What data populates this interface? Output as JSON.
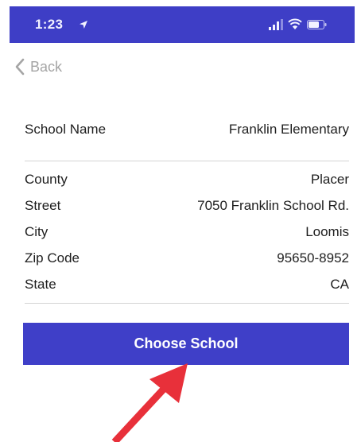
{
  "status_bar": {
    "time": "1:23",
    "location_icon": "location-arrow-icon",
    "signal_icon": "cellular-signal-icon",
    "wifi_icon": "wifi-icon",
    "battery_icon": "battery-icon",
    "background_color": "#3e3ec6"
  },
  "nav": {
    "back_label": "Back",
    "back_icon": "chevron-left-icon"
  },
  "school": {
    "name_label": "School Name",
    "name_value": "Franklin Elementary"
  },
  "details": [
    {
      "label": "County",
      "value": "Placer"
    },
    {
      "label": "Street",
      "value": "7050 Franklin School Rd."
    },
    {
      "label": "City",
      "value": "Loomis"
    },
    {
      "label": "Zip Code",
      "value": "95650-8952"
    },
    {
      "label": "State",
      "value": "CA"
    }
  ],
  "actions": {
    "choose_label": "Choose School",
    "button_color": "#3f3fc8"
  },
  "annotation": {
    "arrow_icon": "red-arrow-pointer",
    "arrow_color": "#e8303a"
  }
}
